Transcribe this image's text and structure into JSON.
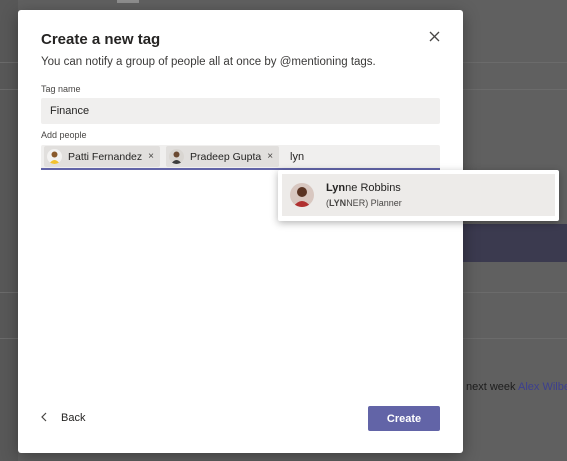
{
  "background": {
    "chat_text": "next week",
    "chat_mention": "Alex Wilber"
  },
  "dialog": {
    "title": "Create a new tag",
    "subtitle": "You can notify a group of people all at once by @mentioning tags.",
    "tag_name_label": "Tag name",
    "tag_name_value": "Finance",
    "add_people_label": "Add people",
    "people": [
      {
        "name": "Patti Fernandez",
        "remove": "×"
      },
      {
        "name": "Pradeep Gupta",
        "remove": "×"
      }
    ],
    "people_query": "lyn",
    "suggestion": {
      "name_match": "Lyn",
      "name_rest": "ne Robbins",
      "sub_open": "(",
      "sub_match": "LYN",
      "sub_rest": "NER) Planner"
    },
    "back_label": "Back",
    "create_label": "Create"
  },
  "colors": {
    "accent": "#6264a7",
    "overlay": "#5c5c5c"
  },
  "icons": {
    "close": "close-icon",
    "back": "chevron-left-icon"
  }
}
